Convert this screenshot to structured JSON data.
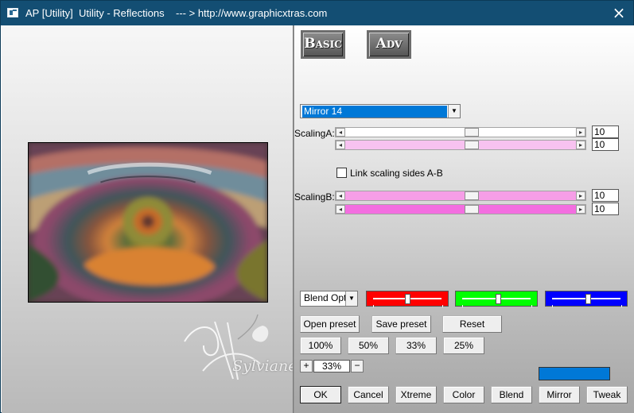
{
  "window": {
    "title": "AP [Utility]  Utility - Reflections    --- > http://www.graphicxtras.com",
    "close_icon": "close-icon",
    "app_icon": "app-window-icon"
  },
  "tabs": [
    {
      "label": "Basic"
    },
    {
      "label": "Adv"
    }
  ],
  "preset_select": {
    "value": "Mirror 14",
    "arrow_icon": "chevron-down-icon"
  },
  "scaling": {
    "a_label": "ScalingA:",
    "b_label": "ScalingB:",
    "link_label": "Link scaling sides A-B",
    "link_checked": false,
    "a_values": [
      10,
      10
    ],
    "b_values": [
      10,
      10
    ],
    "slider_levels": [
      0.5,
      0.5,
      0.5,
      0.5
    ],
    "colors": {
      "a_first": "#ffffff",
      "a_second": "#f7c2f0",
      "b_first": "#f69ee7",
      "b_second": "#f36ee0"
    }
  },
  "blend": {
    "value": "Blend Optio",
    "tracks": [
      {
        "name": "red",
        "color": "#ff0000",
        "level": 0.48
      },
      {
        "name": "green",
        "color": "#00ff00",
        "level": 0.5
      },
      {
        "name": "blue",
        "color": "#0000ff",
        "level": 0.5
      }
    ]
  },
  "actions": {
    "open_preset": "Open preset",
    "save_preset": "Save preset",
    "reset": "Reset"
  },
  "zoom": {
    "buttons": [
      "100%",
      "50%",
      "33%",
      "25%"
    ],
    "value": "33%",
    "plus": "+",
    "minus": "−"
  },
  "bottom_buttons": [
    "OK",
    "Cancel",
    "Xtreme",
    "Color",
    "Blend",
    "Mirror",
    "Tweak"
  ],
  "swatch_color": "#0078d7",
  "watermark": {
    "text": "Sylviane"
  }
}
